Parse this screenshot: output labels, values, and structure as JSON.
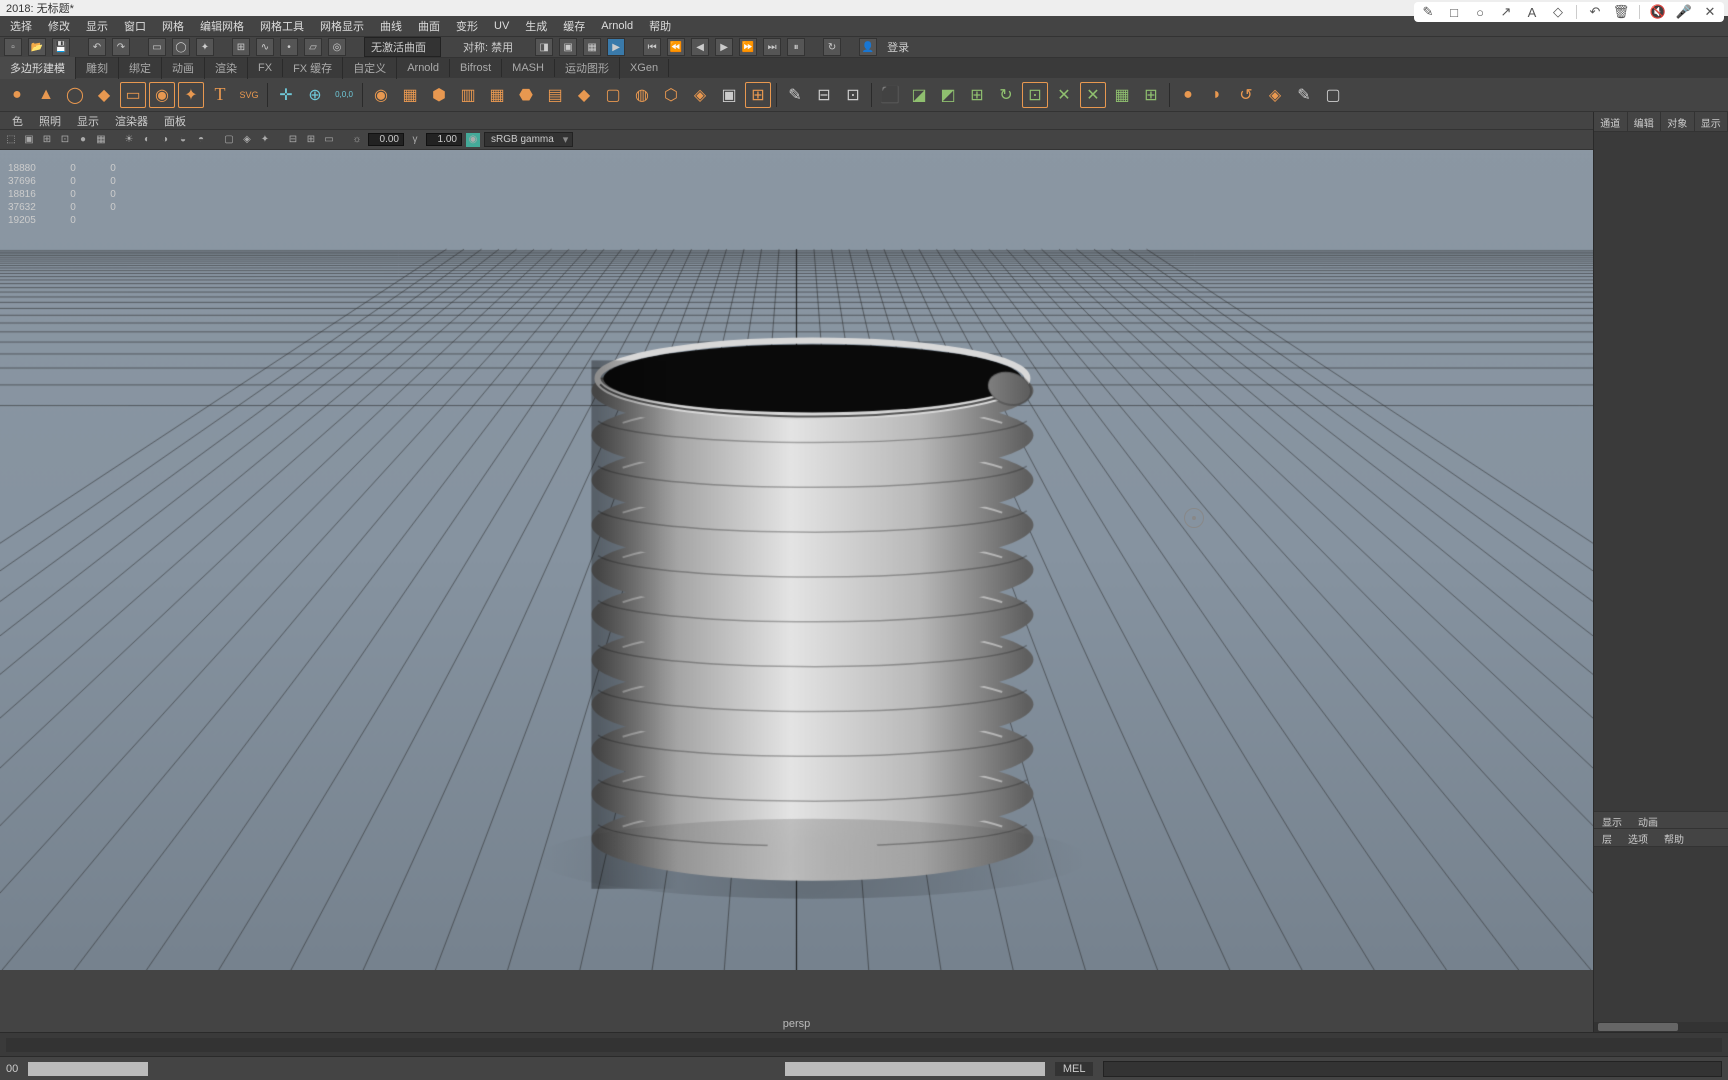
{
  "title": "2018: 无标题*",
  "menu": [
    "选择",
    "修改",
    "显示",
    "窗口",
    "网格",
    "编辑网格",
    "网格工具",
    "网格显示",
    "曲线",
    "曲面",
    "变形",
    "UV",
    "生成",
    "缓存",
    "Arnold",
    "帮助"
  ],
  "status": {
    "left_label": "无激活曲面",
    "mid_label": "对称: 禁用",
    "login": "登录"
  },
  "shelf_tabs": [
    "多边形建模",
    "雕刻",
    "绑定",
    "动画",
    "渲染",
    "FX",
    "FX 缓存",
    "自定义",
    "Arnold",
    "Bifrost",
    "MASH",
    "运动图形",
    "XGen"
  ],
  "vp_menu": [
    "色",
    "照明",
    "显示",
    "渲染器",
    "面板"
  ],
  "vp_tools": {
    "val1": "0.00",
    "val2": "1.00",
    "colorspace": "sRGB gamma"
  },
  "hud_rows": [
    [
      "18880",
      "0",
      "0"
    ],
    [
      "37696",
      "0",
      "0"
    ],
    [
      "18816",
      "0",
      "0"
    ],
    [
      "37632",
      "0",
      "0"
    ],
    [
      "19205",
      "0",
      ""
    ]
  ],
  "persp": "persp",
  "right": {
    "tabs_top": [
      "通道",
      "编辑",
      "对象",
      "显示"
    ],
    "tabs_mid": [
      "显示",
      "动画"
    ],
    "tabs_bot": [
      "层",
      "选项",
      "帮助"
    ]
  },
  "bottom": {
    "frame_val": "00",
    "mel": "MEL"
  },
  "overlay_icons": [
    "pencil",
    "square",
    "circle",
    "arrow",
    "A",
    "eraser",
    "|",
    "undo",
    "trash",
    "|",
    "mute",
    "mic",
    "x"
  ]
}
